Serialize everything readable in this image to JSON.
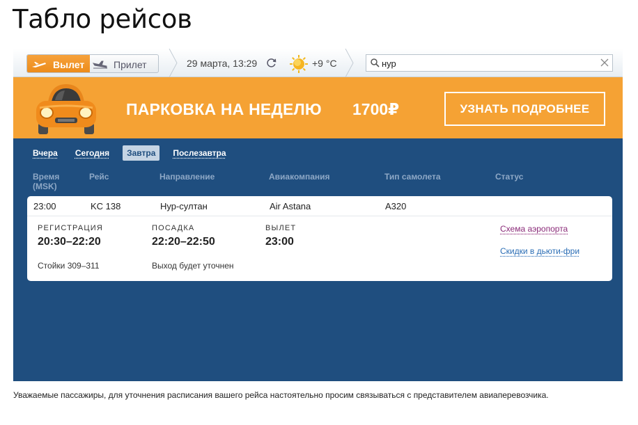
{
  "page": {
    "title": "Табло рейсов"
  },
  "topbar": {
    "departure_label": "Вылет",
    "arrival_label": "Прилет",
    "datetime": "29 марта, 13:29",
    "temperature": "+9 °C",
    "search": {
      "value": "нур",
      "placeholder": ""
    }
  },
  "banner": {
    "text": "ПАРКОВКА НА НЕДЕЛЮ",
    "price": "1700₽",
    "button_label": "УЗНАТЬ ПОДРОБНЕЕ"
  },
  "days": [
    "Вчера",
    "Сегодня",
    "Завтра",
    "Послезавтра"
  ],
  "active_day": "Завтра",
  "columns": {
    "time": "Время",
    "time_zone": "(MSK)",
    "flight": "Рейс",
    "direction": "Направление",
    "airline": "Авиакомпания",
    "aircraft": "Тип самолета",
    "status": "Статус"
  },
  "flight": {
    "time": "23:00",
    "number": "KC 138",
    "direction": "Нур-султан",
    "airline": "Air Astana",
    "aircraft": "A320",
    "status": "",
    "registration_label": "РЕГИСТРАЦИЯ",
    "registration_time": "20:30–22:20",
    "counters": "Стойки 309–311",
    "boarding_label": "ПОСАДКА",
    "boarding_time": "22:20–22:50",
    "gate": "Выход будет уточнен",
    "departure_label": "ВЫЛЕТ",
    "departure_time": "23:00",
    "airport_map_link": "Схема аэропорта",
    "dutyfree_link": "Скидки в дьюти-фри"
  },
  "footnote": "Уважаемые пассажиры, для уточнения расписания вашего рейса настоятельно просим связываться с представителем авиаперевозчика.",
  "colors": {
    "accent_orange": "#f5a234",
    "board_blue": "#1f4e7f",
    "link_purple": "#8a2a78",
    "link_blue": "#2a6db5"
  },
  "icons": [
    "plane-departure-icon",
    "plane-arrival-icon",
    "refresh-icon",
    "sun-icon",
    "search-icon",
    "close-icon",
    "car-icon"
  ]
}
